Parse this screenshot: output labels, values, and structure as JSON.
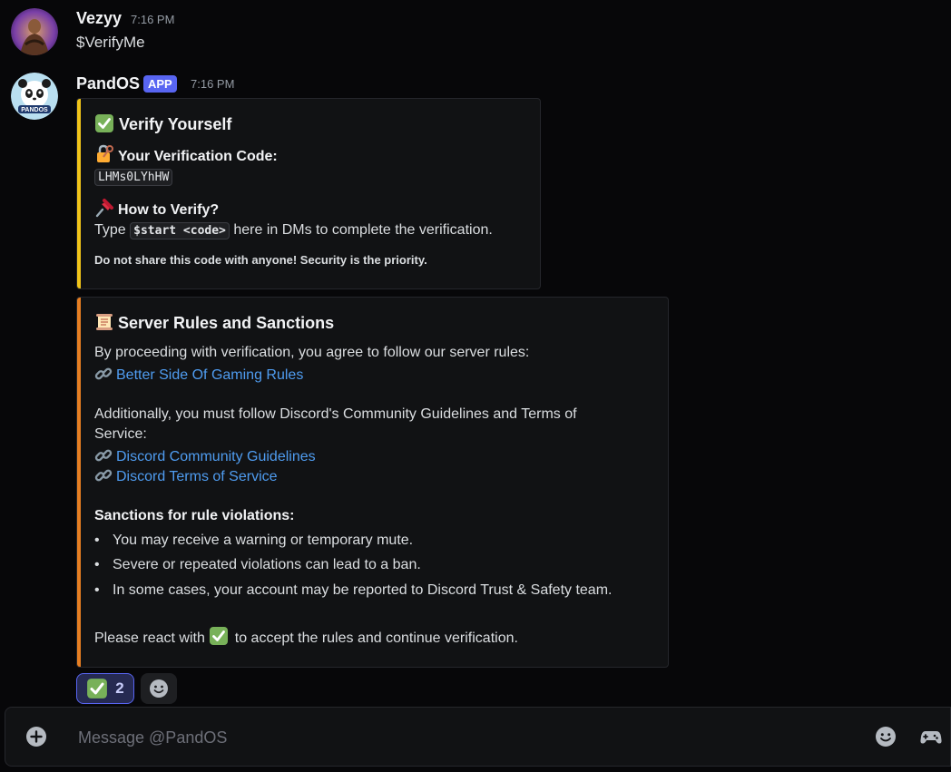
{
  "messages": [
    {
      "username": "Vezyy",
      "timestamp": "7:16 PM",
      "text": "$VerifyMe"
    },
    {
      "username": "PandOS",
      "badge": "APP",
      "timestamp": "7:16 PM",
      "avatar_label": "PANDOS"
    }
  ],
  "embed_verify": {
    "accent_color": "#f0c419",
    "title": "Verify Yourself",
    "title_icon": "check-mark-emoji",
    "code_label": "Your Verification Code:",
    "code_icon": "lock-key-emoji",
    "code_value": "LHMs0LYhHW",
    "how_label": "How to Verify?",
    "how_icon": "pushpin-emoji",
    "instr_prefix": "Type",
    "instr_code": "$start <code>",
    "instr_suffix": "here in DMs to complete the verification.",
    "warning": "Do not share this code with anyone! Security is the priority."
  },
  "embed_rules": {
    "accent_color": "#e67e22",
    "title": "Server Rules and Sanctions",
    "title_icon": "scroll-emoji",
    "intro": "By proceeding with verification, you agree to follow our server rules:",
    "link_rules": "Better Side Of Gaming Rules",
    "additional_line1": "Additionally, you must follow Discord's Community Guidelines and Terms of",
    "additional_line2": "Service:",
    "link_guidelines": "Discord Community Guidelines",
    "link_tos": "Discord Terms of Service",
    "sanctions_title": "Sanctions for rule violations:",
    "sanctions": [
      "You may receive a warning or temporary mute.",
      "Severe or repeated violations can lead to a ban.",
      "In some cases, your account may be reported to Discord Trust & Safety team."
    ],
    "react_prefix": "Please react with",
    "react_suffix": "to accept the rules and continue verification."
  },
  "reactions": {
    "check_count": "2"
  },
  "composer": {
    "placeholder": "Message @PandOS"
  }
}
